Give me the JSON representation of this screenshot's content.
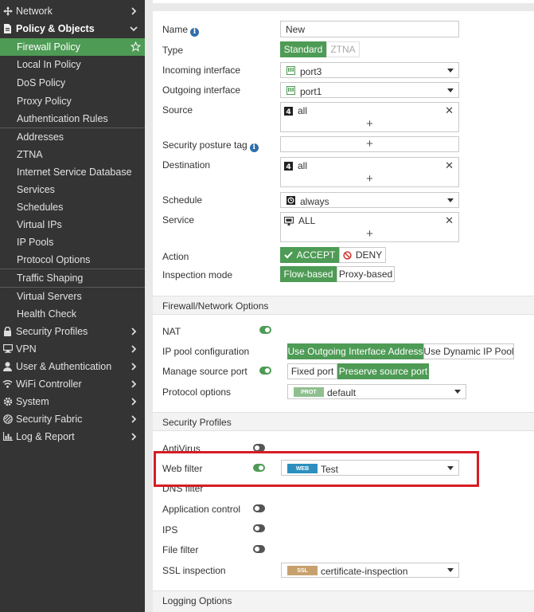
{
  "sidebar": {
    "top_items": [
      {
        "label": "Network",
        "icon": "network-icon"
      },
      {
        "label": "Policy & Objects",
        "icon": "policy-objects-icon"
      }
    ],
    "sub_items": [
      {
        "label": "Firewall Policy"
      },
      {
        "label": "Local In Policy"
      },
      {
        "label": "DoS Policy"
      },
      {
        "label": "Proxy Policy"
      },
      {
        "label": "Authentication Rules"
      },
      {
        "label": "Addresses"
      },
      {
        "label": "ZTNA"
      },
      {
        "label": "Internet Service Database"
      },
      {
        "label": "Services"
      },
      {
        "label": "Schedules"
      },
      {
        "label": "Virtual IPs"
      },
      {
        "label": "IP Pools"
      },
      {
        "label": "Protocol Options"
      },
      {
        "label": "Traffic Shaping"
      },
      {
        "label": "Virtual Servers"
      },
      {
        "label": "Health Check"
      }
    ],
    "bottom_items": [
      {
        "label": "Security Profiles",
        "icon": "lock-icon"
      },
      {
        "label": "VPN",
        "icon": "vpn-icon"
      },
      {
        "label": "User & Authentication",
        "icon": "user-icon"
      },
      {
        "label": "WiFi Controller",
        "icon": "wifi-icon"
      },
      {
        "label": "System",
        "icon": "gear-icon"
      },
      {
        "label": "Security Fabric",
        "icon": "fabric-icon"
      },
      {
        "label": "Log & Report",
        "icon": "chart-icon"
      }
    ]
  },
  "form": {
    "name_label": "Name",
    "name_value": "New",
    "type_label": "Type",
    "type_options": [
      "Standard",
      "ZTNA"
    ],
    "incoming_label": "Incoming interface",
    "incoming_value": "port3",
    "outgoing_label": "Outgoing interface",
    "outgoing_value": "port1",
    "source_label": "Source",
    "source_value": "all",
    "posture_label": "Security posture tag",
    "destination_label": "Destination",
    "destination_value": "all",
    "schedule_label": "Schedule",
    "schedule_value": "always",
    "service_label": "Service",
    "service_value": "ALL",
    "action_label": "Action",
    "action_accept": "ACCEPT",
    "action_deny": "DENY",
    "inspection_label": "Inspection mode",
    "inspection_options": [
      "Flow-based",
      "Proxy-based"
    ],
    "plus": "+",
    "remove": "✕"
  },
  "firewall_options": {
    "section_title": "Firewall/Network Options",
    "nat_label": "NAT",
    "ippool_label": "IP pool configuration",
    "ippool_options": [
      "Use Outgoing Interface Address",
      "Use Dynamic IP Pool"
    ],
    "manage_port_label": "Manage source port",
    "port_options": [
      "Fixed port",
      "Preserve source port"
    ],
    "protocol_label": "Protocol options",
    "protocol_tag": "PROT",
    "protocol_value": "default"
  },
  "security_profiles": {
    "section_title": "Security Profiles",
    "antivirus_label": "AntiVirus",
    "webfilter_label": "Web filter",
    "webfilter_tag": "WEB",
    "webfilter_value": "Test",
    "dns_label": "DNS filter",
    "appctrl_label": "Application control",
    "ips_label": "IPS",
    "filefilter_label": "File filter",
    "ssl_label": "SSL inspection",
    "ssl_tag": "SSL",
    "ssl_value": "certificate-inspection"
  },
  "logging": {
    "section_title": "Logging Options"
  },
  "colors": {
    "accent": "#4e9b55",
    "sidebar": "#343434",
    "highlight": "#d71c24",
    "info": "#2f6ea8"
  }
}
